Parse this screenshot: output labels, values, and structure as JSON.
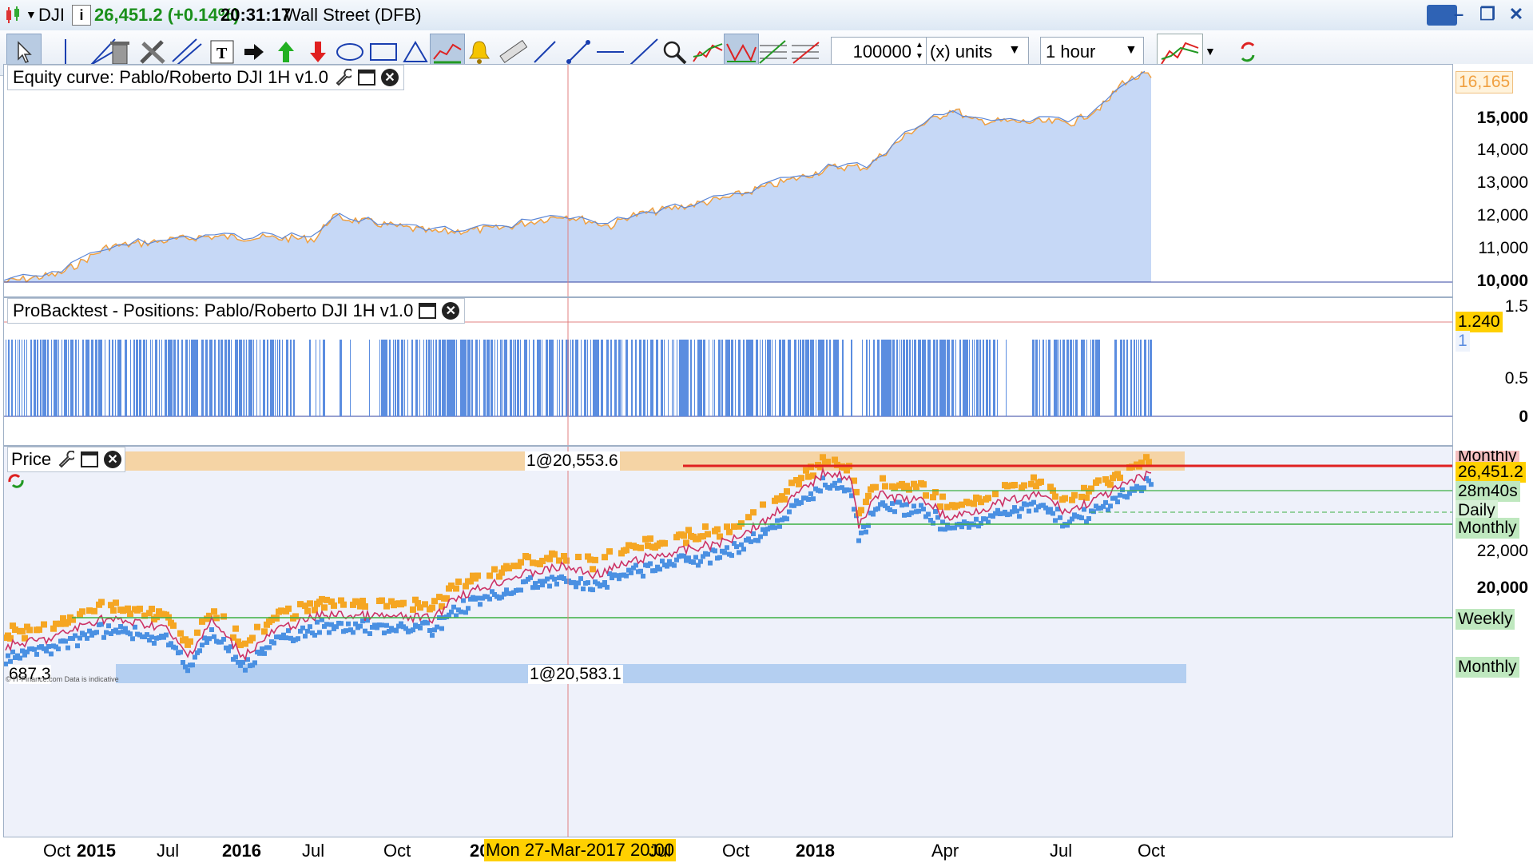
{
  "titlebar": {
    "symbol": "DJI",
    "price_change": "26,451.2 (+0.14%)",
    "time": "20:31:17",
    "instrument": "Wall Street (DFB)"
  },
  "toolbar": {
    "quantity": "100000",
    "units": "(x) units",
    "timeframe": "1 hour"
  },
  "equity_panel": {
    "title": "Equity curve: Pablo/Roberto DJI 1H v1.0",
    "axis_labels": [
      "15,000",
      "14,000",
      "13,000",
      "12,000",
      "11,000",
      "10,000"
    ],
    "current_value": "16,165",
    "bold_labels": [
      "15,000",
      "10,000"
    ]
  },
  "positions_panel": {
    "title": "ProBacktest - Positions: Pablo/Roberto DJI 1H v1.0",
    "axis_labels": [
      "1.5",
      "0.5",
      "0"
    ],
    "current_value": "1.240",
    "tag_1": "1"
  },
  "price_panel": {
    "title": "Price",
    "top_value_label": "1@20,553.6",
    "bottom_value_label": "1@20,583.1",
    "left_bottom_value": "687.3",
    "axis_labels": [
      "22,000",
      "20,000"
    ],
    "current_price": "26,451.2",
    "countdown": "28m40s",
    "tags": {
      "monthly_top": "Monthly",
      "daily": "Daily",
      "monthly_mid": "Monthly",
      "weekly": "Weekly",
      "monthly_bottom": "Monthly"
    },
    "footer_credit": "© IT-Finance.com  Data is indicative"
  },
  "x_axis": {
    "labels": [
      "Oct",
      "2015",
      "Jul",
      "2016",
      "Jul",
      "Oct",
      "20",
      "Jul",
      "Oct",
      "2018",
      "Apr",
      "Jul",
      "Oct"
    ],
    "bold_labels": [
      "2015",
      "2016",
      "2018"
    ],
    "cursor_label": "Mon 27-Mar-2017 20:00"
  },
  "colors": {
    "equity_fill": "#c6d8f6",
    "equity_line": "#f0a040",
    "equity_step": "#5b86d6",
    "positions_bar": "#5b8de0",
    "price_up": "#f5a623",
    "price_down": "#4a90e2",
    "ma_line": "#cc3366",
    "support_line": "#3cb043",
    "current_line": "#e02020",
    "value_tag_bg": "#ffd000"
  }
}
